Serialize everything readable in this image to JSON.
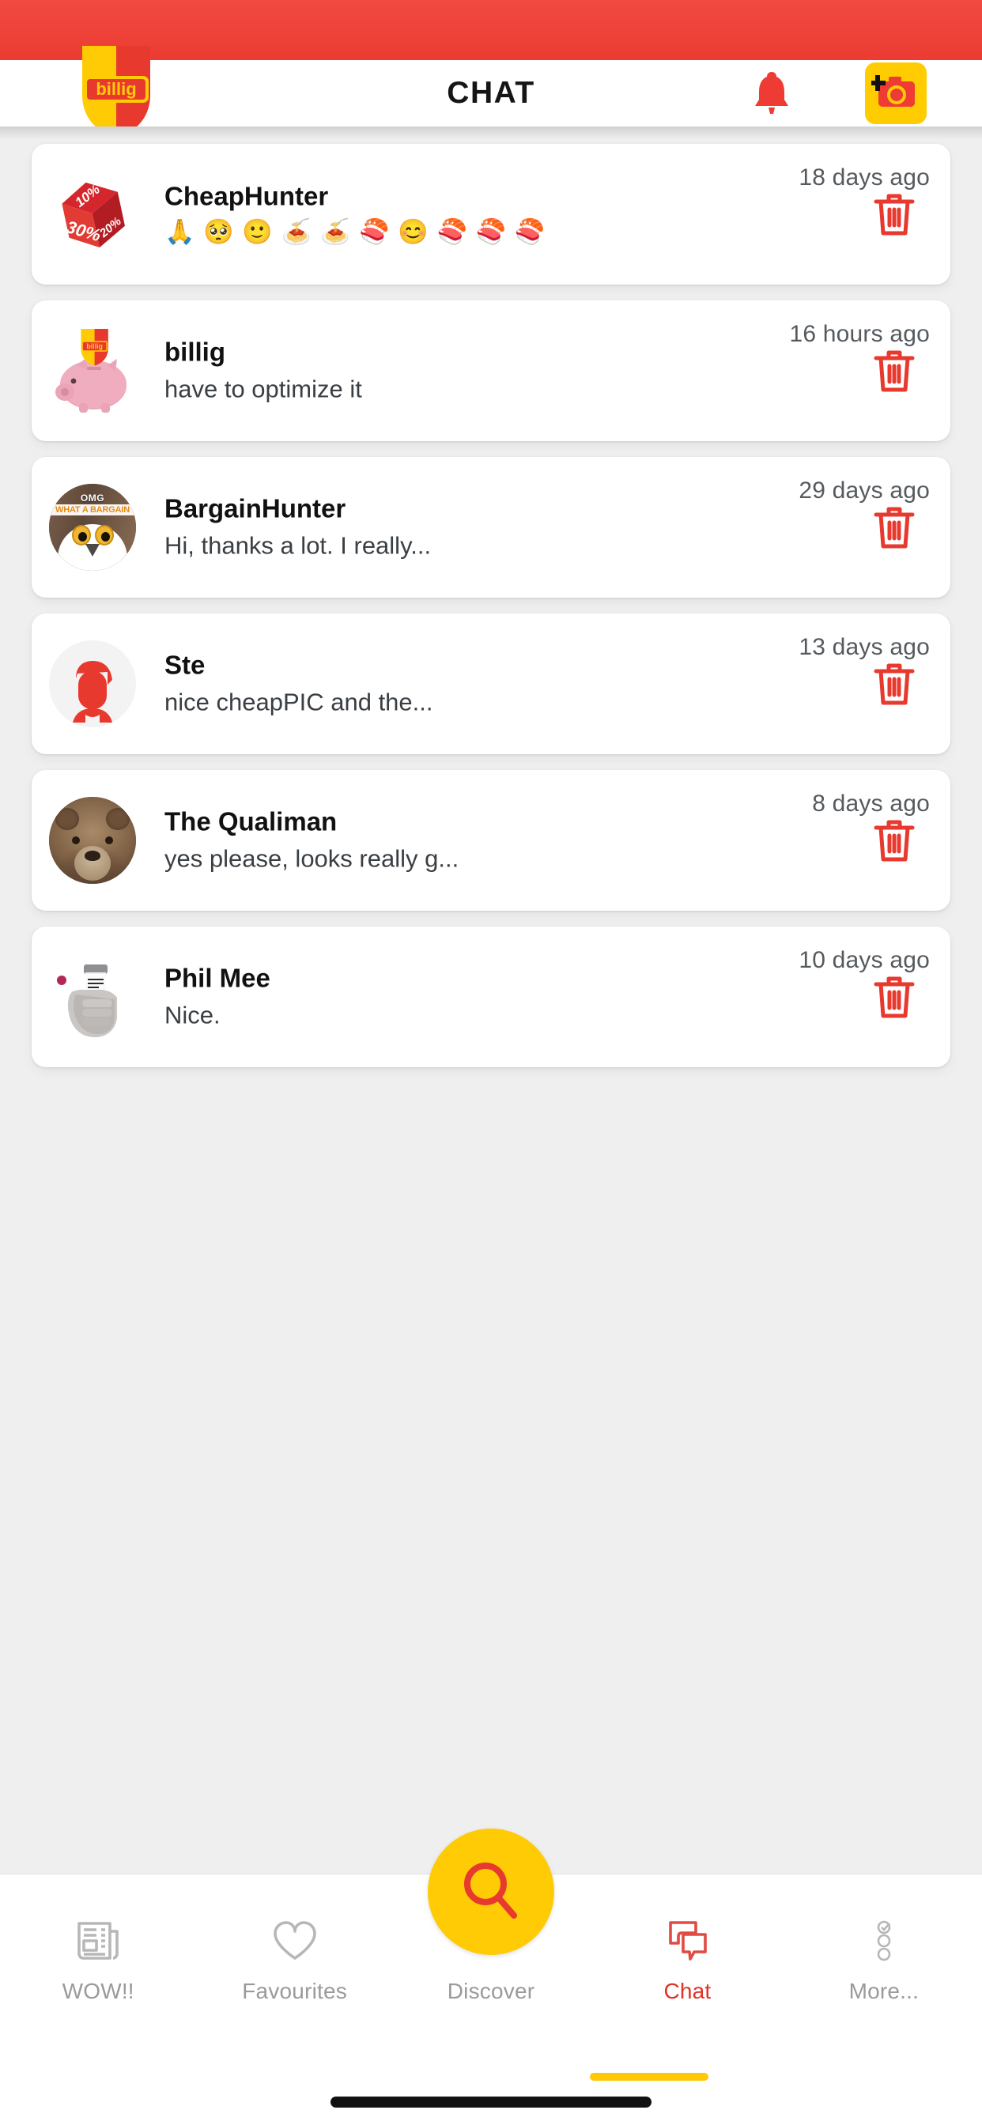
{
  "app": {
    "brand_name": "billig",
    "accent_red": "#e03127",
    "accent_yellow": "#ffcb05",
    "status_bar_color": "#ee3f36"
  },
  "header": {
    "title": "CHAT",
    "logo_text": "billig",
    "bell_icon": "bell-icon",
    "camera_icon": "add-photo-camera-icon"
  },
  "chats": [
    {
      "name": "CheapHunter",
      "message": "🙏 🥺 🙂 🍝 🍝 🍣 😊 🍣 🍣 🍣",
      "is_emoji": true,
      "time": "18 days ago",
      "avatar": "discount-cube-avatar",
      "avatar_labels": [
        "10%",
        "30%",
        "20%"
      ]
    },
    {
      "name": "billig",
      "message": "have to optimize it",
      "is_emoji": false,
      "time": "16 hours ago",
      "avatar": "piggy-bank-avatar",
      "avatar_labels": [
        "billig"
      ]
    },
    {
      "name": "BargainHunter",
      "message": "Hi, thanks a lot. I really...",
      "is_emoji": false,
      "time": "29 days ago",
      "avatar": "owl-meme-avatar",
      "avatar_labels": [
        "OMG",
        "WHAT A BARGAIN"
      ]
    },
    {
      "name": "Ste",
      "message": "nice cheapPIC and the...",
      "is_emoji": false,
      "time": "13 days ago",
      "avatar": "default-person-avatar",
      "avatar_labels": []
    },
    {
      "name": "The Qualiman",
      "message": "yes please, looks really g...",
      "is_emoji": false,
      "time": "8 days ago",
      "avatar": "bear-avatar",
      "avatar_labels": []
    },
    {
      "name": "Phil Mee",
      "message": "Nice.",
      "is_emoji": false,
      "time": "10 days ago",
      "avatar": "hand-holding-bottle-avatar",
      "avatar_labels": []
    }
  ],
  "delete_icon": "trash-icon",
  "fab": {
    "icon": "search-icon",
    "label": "Discover"
  },
  "bottom_nav": {
    "items": [
      {
        "label": "WOW!!",
        "icon": "newspaper-icon",
        "active": false
      },
      {
        "label": "Favourites",
        "icon": "heart-icon",
        "active": false
      },
      {
        "label": "Discover",
        "icon": "search-icon",
        "active": false
      },
      {
        "label": "Chat",
        "icon": "chat-bubbles-icon",
        "active": true
      },
      {
        "label": "More...",
        "icon": "more-dots-icon",
        "active": false
      }
    ]
  }
}
